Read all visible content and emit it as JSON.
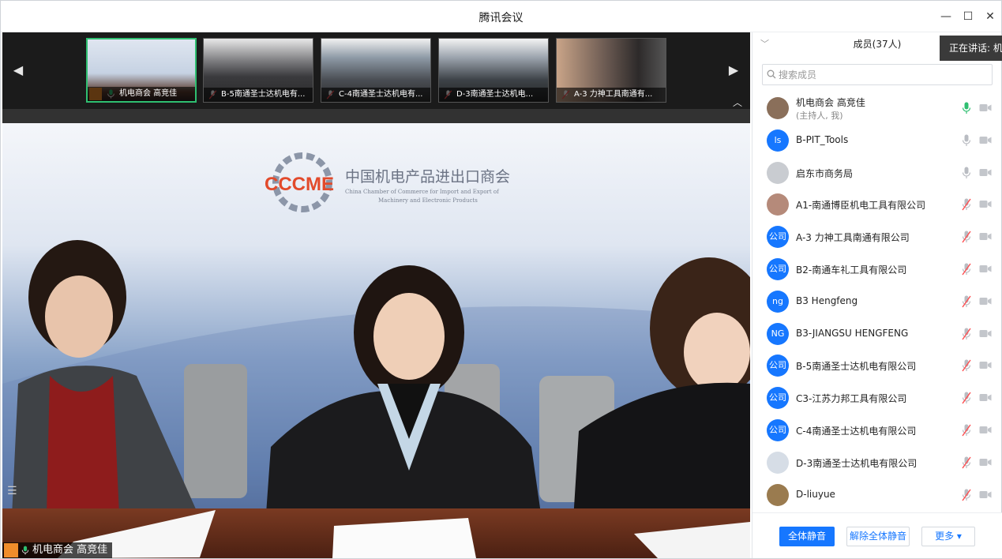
{
  "window": {
    "title": "腾讯会议"
  },
  "strip": {
    "thumbnails": [
      {
        "label": "机电商会 高竞佳",
        "active": true
      },
      {
        "label": "B-5南通圣士达机电有...",
        "active": false
      },
      {
        "label": "C-4南通圣士达机电有...",
        "active": false
      },
      {
        "label": "D-3南通圣士达机电...",
        "active": false
      },
      {
        "label": "A-3 力神工具南通有...",
        "active": false
      }
    ]
  },
  "main_video": {
    "speaker_label": "机电商会 高竞佳",
    "backdrop": {
      "logo": "CCCME",
      "org_name_cn": "中国机电产品进出口商会",
      "org_name_en_1": "China Chamber of Commerce for Import and Export of",
      "org_name_en_2": "Machinery and Electronic Products"
    }
  },
  "panel": {
    "title": "成员(37人)",
    "speaking_tooltip": "正在讲话: 机电",
    "search_placeholder": "搜索成员",
    "members": [
      {
        "name": "机电商会 高竞佳",
        "sub": "(主持人, 我)",
        "avatar_text": "",
        "avatar_color": "#8a6f5a",
        "mic": "on"
      },
      {
        "name": "B-PIT_Tools",
        "sub": "",
        "avatar_text": "ls",
        "avatar_color": "#1677ff",
        "mic": "idle"
      },
      {
        "name": "启东市商务局",
        "sub": "",
        "avatar_text": "",
        "avatar_color": "#c9ccd1",
        "mic": "idle"
      },
      {
        "name": "A1-南通博臣机电工具有限公司",
        "sub": "",
        "avatar_text": "",
        "avatar_color": "#b58a7a",
        "mic": "muted"
      },
      {
        "name": "A-3 力神工具南通有限公司",
        "sub": "",
        "avatar_text": "公司",
        "avatar_color": "#1677ff",
        "mic": "muted"
      },
      {
        "name": "B2-南通车礼工具有限公司",
        "sub": "",
        "avatar_text": "公司",
        "avatar_color": "#1677ff",
        "mic": "muted"
      },
      {
        "name": "B3 Hengfeng",
        "sub": "",
        "avatar_text": "ng",
        "avatar_color": "#1677ff",
        "mic": "muted"
      },
      {
        "name": "B3-JIANGSU HENGFENG",
        "sub": "",
        "avatar_text": "NG",
        "avatar_color": "#1677ff",
        "mic": "muted"
      },
      {
        "name": "B-5南通圣士达机电有限公司",
        "sub": "",
        "avatar_text": "公司",
        "avatar_color": "#1677ff",
        "mic": "muted"
      },
      {
        "name": "C3-江苏力邦工具有限公司",
        "sub": "",
        "avatar_text": "公司",
        "avatar_color": "#1677ff",
        "mic": "muted"
      },
      {
        "name": "C-4南通圣士达机电有限公司",
        "sub": "",
        "avatar_text": "公司",
        "avatar_color": "#1677ff",
        "mic": "muted"
      },
      {
        "name": "D-3南通圣士达机电有限公司",
        "sub": "",
        "avatar_text": "",
        "avatar_color": "#d6dde6",
        "mic": "muted"
      },
      {
        "name": "D-liuyue",
        "sub": "",
        "avatar_text": "",
        "avatar_color": "#9a7b4f",
        "mic": "muted"
      }
    ],
    "buttons": {
      "mute_all": "全体静音",
      "unmute_all": "解除全体静音",
      "more": "更多 ▾"
    }
  }
}
